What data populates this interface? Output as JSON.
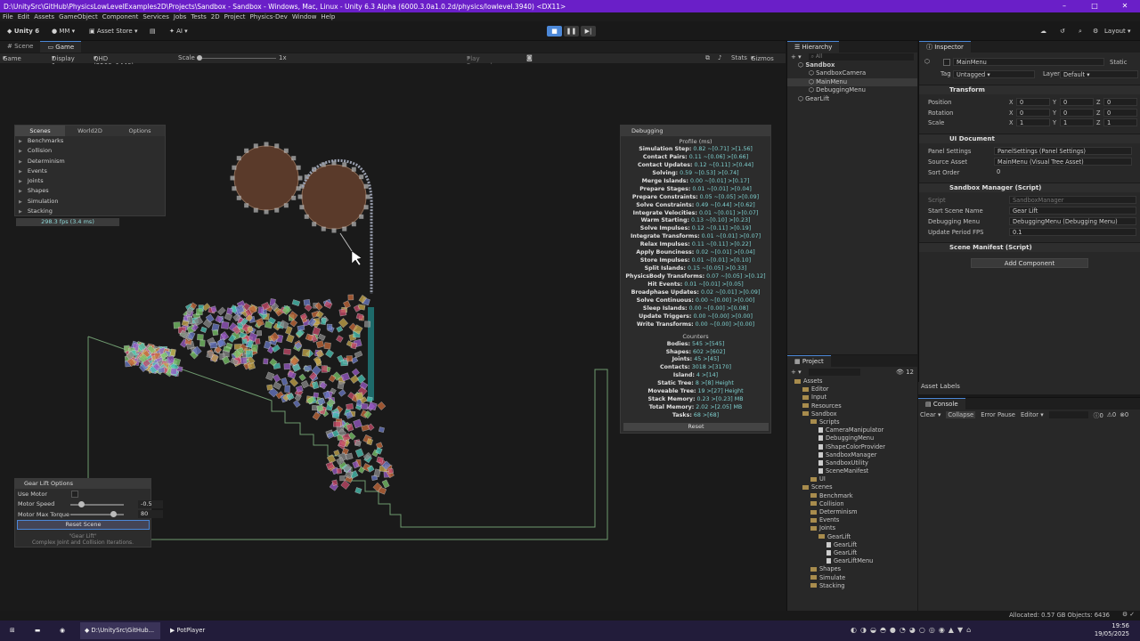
{
  "window": {
    "title": "D:\\UnitySrc\\GitHub\\PhysicsLowLevelExamples2D\\Projects\\Sandbox - Sandbox - Windows, Mac, Linux - Unity 6.3 Alpha (6000.3.0a1.0.2d/physics/lowlevel.3940) <DX11>"
  },
  "menu": [
    "File",
    "Edit",
    "Assets",
    "GameObject",
    "Component",
    "Services",
    "Jobs",
    "Tests",
    "2D",
    "Project",
    "Physics-Dev",
    "Window",
    "Help"
  ],
  "toolbar": {
    "unity": "Unity 6",
    "account": "MM",
    "asset_store": "Asset Store",
    "ai": "AI",
    "layout": "Layout"
  },
  "scene_tabs": [
    "Scene",
    "Game"
  ],
  "game_toolbar": {
    "mode": "Game",
    "display": "Display 1",
    "resolution": "QHD (2560x1440)",
    "scale_label": "Scale",
    "scale_value": "1x",
    "play_focused": "Play Focused",
    "stats": "Stats",
    "gizmos": "Gizmos"
  },
  "scenes_panel": {
    "tabs": [
      "Scenes",
      "World2D",
      "Options"
    ],
    "items": [
      "Benchmarks",
      "Collision",
      "Determinism",
      "Events",
      "Joints",
      "Shapes",
      "Simulation",
      "Stacking"
    ],
    "fps": "298.3 fps (3.4 ms)"
  },
  "debug_panel": {
    "title": "Debugging",
    "profile_header": "Profile (ms)",
    "profile": [
      {
        "l": "Simulation Step:",
        "v": "0.82 ~[0.71] >[1.56]"
      },
      {
        "l": "Contact Pairs:",
        "v": "0.11 ~[0.06] >[0.66]"
      },
      {
        "l": "Contact Updates:",
        "v": "0.12 ~[0.11] >[0.44]"
      },
      {
        "l": "Solving:",
        "v": "0.59 ~[0.53] >[0.74]"
      },
      {
        "l": "Merge Islands:",
        "v": "0.00 ~[0.01] >[0.17]"
      },
      {
        "l": "Prepare Stages:",
        "v": "0.01 ~[0.01] >[0.04]"
      },
      {
        "l": "Prepare Constraints:",
        "v": "0.05 ~[0.05] >[0.09]"
      },
      {
        "l": "Solve Constraints:",
        "v": "0.49 ~[0.44] >[0.62]"
      },
      {
        "l": "Integrate Velocities:",
        "v": "0.01 ~[0.01] >[0.07]"
      },
      {
        "l": "Warm Starting:",
        "v": "0.13 ~[0.10] >[0.23]"
      },
      {
        "l": "Solve Impulses:",
        "v": "0.12 ~[0.11] >[0.19]"
      },
      {
        "l": "Integrate Transforms:",
        "v": "0.01 ~[0.01] >[0.07]"
      },
      {
        "l": "Relax Impulses:",
        "v": "0.11 ~[0.11] >[0.22]"
      },
      {
        "l": "Apply Bounciness:",
        "v": "0.02 ~[0.01] >[0.04]"
      },
      {
        "l": "Store Impulses:",
        "v": "0.01 ~[0.01] >[0.10]"
      },
      {
        "l": "Split Islands:",
        "v": "0.15 ~[0.05] >[0.33]"
      },
      {
        "l": "PhysicsBody Transforms:",
        "v": "0.07 ~[0.05] >[0.12]"
      },
      {
        "l": "Hit Events:",
        "v": "0.01 ~[0.01] >[0.05]"
      },
      {
        "l": "Broadphase Updates:",
        "v": "0.02 ~[0.01] >[0.09]"
      },
      {
        "l": "Solve Continuous:",
        "v": "0.00 ~[0.00] >[0.00]"
      },
      {
        "l": "Sleep Islands:",
        "v": "0.00 ~[0.00] >[0.08]"
      },
      {
        "l": "Update Triggers:",
        "v": "0.00 ~[0.00] >[0.00]"
      },
      {
        "l": "Write Transforms:",
        "v": "0.00 ~[0.00] >[0.00]"
      }
    ],
    "counters_header": "Counters",
    "counters": [
      {
        "l": "Bodies:",
        "v": "545 >[545]"
      },
      {
        "l": "Shapes:",
        "v": "602 >[602]"
      },
      {
        "l": "Joints:",
        "v": "45 >[45]"
      },
      {
        "l": "Contacts:",
        "v": "3018 >[3170]"
      },
      {
        "l": "Island:",
        "v": "4 >[14]"
      },
      {
        "l": "Static Tree:",
        "v": "8 >[8] Height"
      },
      {
        "l": "Moveable Tree:",
        "v": "19 >[27] Height"
      },
      {
        "l": "Stack Memory:",
        "v": "0.23 >[0.23] MB"
      },
      {
        "l": "Total Memory:",
        "v": "2.02 >[2.05] MB"
      },
      {
        "l": "Tasks:",
        "v": "68 >[68]"
      }
    ],
    "reset": "Reset"
  },
  "gear_panel": {
    "title": "Gear Lift Options",
    "use_motor": "Use Motor",
    "motor_speed_label": "Motor Speed",
    "motor_speed": "-0.5",
    "motor_speed_level": 0.2,
    "torque_label": "Motor Max Torque",
    "torque": "80",
    "torque_level": 0.8,
    "reset": "Reset Scene",
    "caption1": "\"Gear Lift\"",
    "caption2": "Complex Joint and Collision Iterations."
  },
  "hierarchy": {
    "title": "Hierarchy",
    "search": "All",
    "items": [
      {
        "t": "Sandbox",
        "indent": 1,
        "bold": true
      },
      {
        "t": "SandboxCamera",
        "indent": 2
      },
      {
        "t": "MainMenu",
        "indent": 2,
        "sel": true
      },
      {
        "t": "DebuggingMenu",
        "indent": 2
      },
      {
        "t": "GearLift",
        "indent": 1
      }
    ]
  },
  "project": {
    "title": "Project",
    "count": "12",
    "items": [
      {
        "t": "Assets",
        "indent": 0,
        "f": true
      },
      {
        "t": "Editor",
        "indent": 1,
        "f": true
      },
      {
        "t": "Input",
        "indent": 1,
        "f": true
      },
      {
        "t": "Resources",
        "indent": 1,
        "f": true
      },
      {
        "t": "Sandbox",
        "indent": 1,
        "f": true
      },
      {
        "t": "Scripts",
        "indent": 2,
        "f": true
      },
      {
        "t": "CameraManipulator",
        "indent": 3
      },
      {
        "t": "DebuggingMenu",
        "indent": 3
      },
      {
        "t": "IShapeColorProvider",
        "indent": 3
      },
      {
        "t": "SandboxManager",
        "indent": 3
      },
      {
        "t": "SandboxUtility",
        "indent": 3
      },
      {
        "t": "SceneManifest",
        "indent": 3
      },
      {
        "t": "UI",
        "indent": 2,
        "f": true
      },
      {
        "t": "Scenes",
        "indent": 1,
        "f": true
      },
      {
        "t": "Benchmark",
        "indent": 2,
        "f": true
      },
      {
        "t": "Collision",
        "indent": 2,
        "f": true
      },
      {
        "t": "Determinism",
        "indent": 2,
        "f": true
      },
      {
        "t": "Events",
        "indent": 2,
        "f": true
      },
      {
        "t": "Joints",
        "indent": 2,
        "f": true
      },
      {
        "t": "GearLift",
        "indent": 3,
        "f": true
      },
      {
        "t": "GearLift",
        "indent": 4
      },
      {
        "t": "GearLift",
        "indent": 4
      },
      {
        "t": "GearLiftMenu",
        "indent": 4
      },
      {
        "t": "Shapes",
        "indent": 2,
        "f": true
      },
      {
        "t": "Simulate",
        "indent": 2,
        "f": true
      },
      {
        "t": "Stacking",
        "indent": 2,
        "f": true
      }
    ]
  },
  "inspector": {
    "title": "Inspector",
    "object": "MainMenu",
    "static": "Static",
    "tag_label": "Tag",
    "tag": "Untagged",
    "layer_label": "Layer",
    "layer": "Default",
    "transform": "Transform",
    "position": "Position",
    "rotation": "Rotation",
    "scale": "Scale",
    "pos": [
      "0",
      "0",
      "0"
    ],
    "rot": [
      "0",
      "0",
      "0"
    ],
    "scl": [
      "1",
      "1",
      "1"
    ],
    "ui_document": "UI Document",
    "panel_settings_label": "Panel Settings",
    "panel_settings": "PanelSettings (Panel Settings)",
    "source_asset_label": "Source Asset",
    "source_asset": "MainMenu (Visual Tree Asset)",
    "sort_order_label": "Sort Order",
    "sort_order": "0",
    "sandbox_manager": "Sandbox Manager (Script)",
    "script_label": "Script",
    "script": "SandboxManager",
    "start_scene_label": "Start Scene Name",
    "start_scene": "Gear Lift",
    "debug_menu_label": "Debugging Menu",
    "debug_menu": "DebuggingMenu (Debugging Menu)",
    "update_fps_label": "Update Period FPS",
    "update_fps": "0.1",
    "scene_manifest": "Scene Manifest (Script)",
    "add_component": "Add Component"
  },
  "asset_labels": "Asset Labels",
  "console": {
    "title": "Console",
    "clear": "Clear",
    "collapse": "Collapse",
    "error_pause": "Error Pause",
    "editor": "Editor",
    "c1": "0",
    "c2": "0",
    "c3": "0"
  },
  "status": "Allocated: 0.57 GB Objects: 6436",
  "taskbar": {
    "app1": "D:\\UnitySrc\\GitHub...",
    "app2": "PotPlayer",
    "time": "19:56",
    "date": "19/05/2025"
  }
}
